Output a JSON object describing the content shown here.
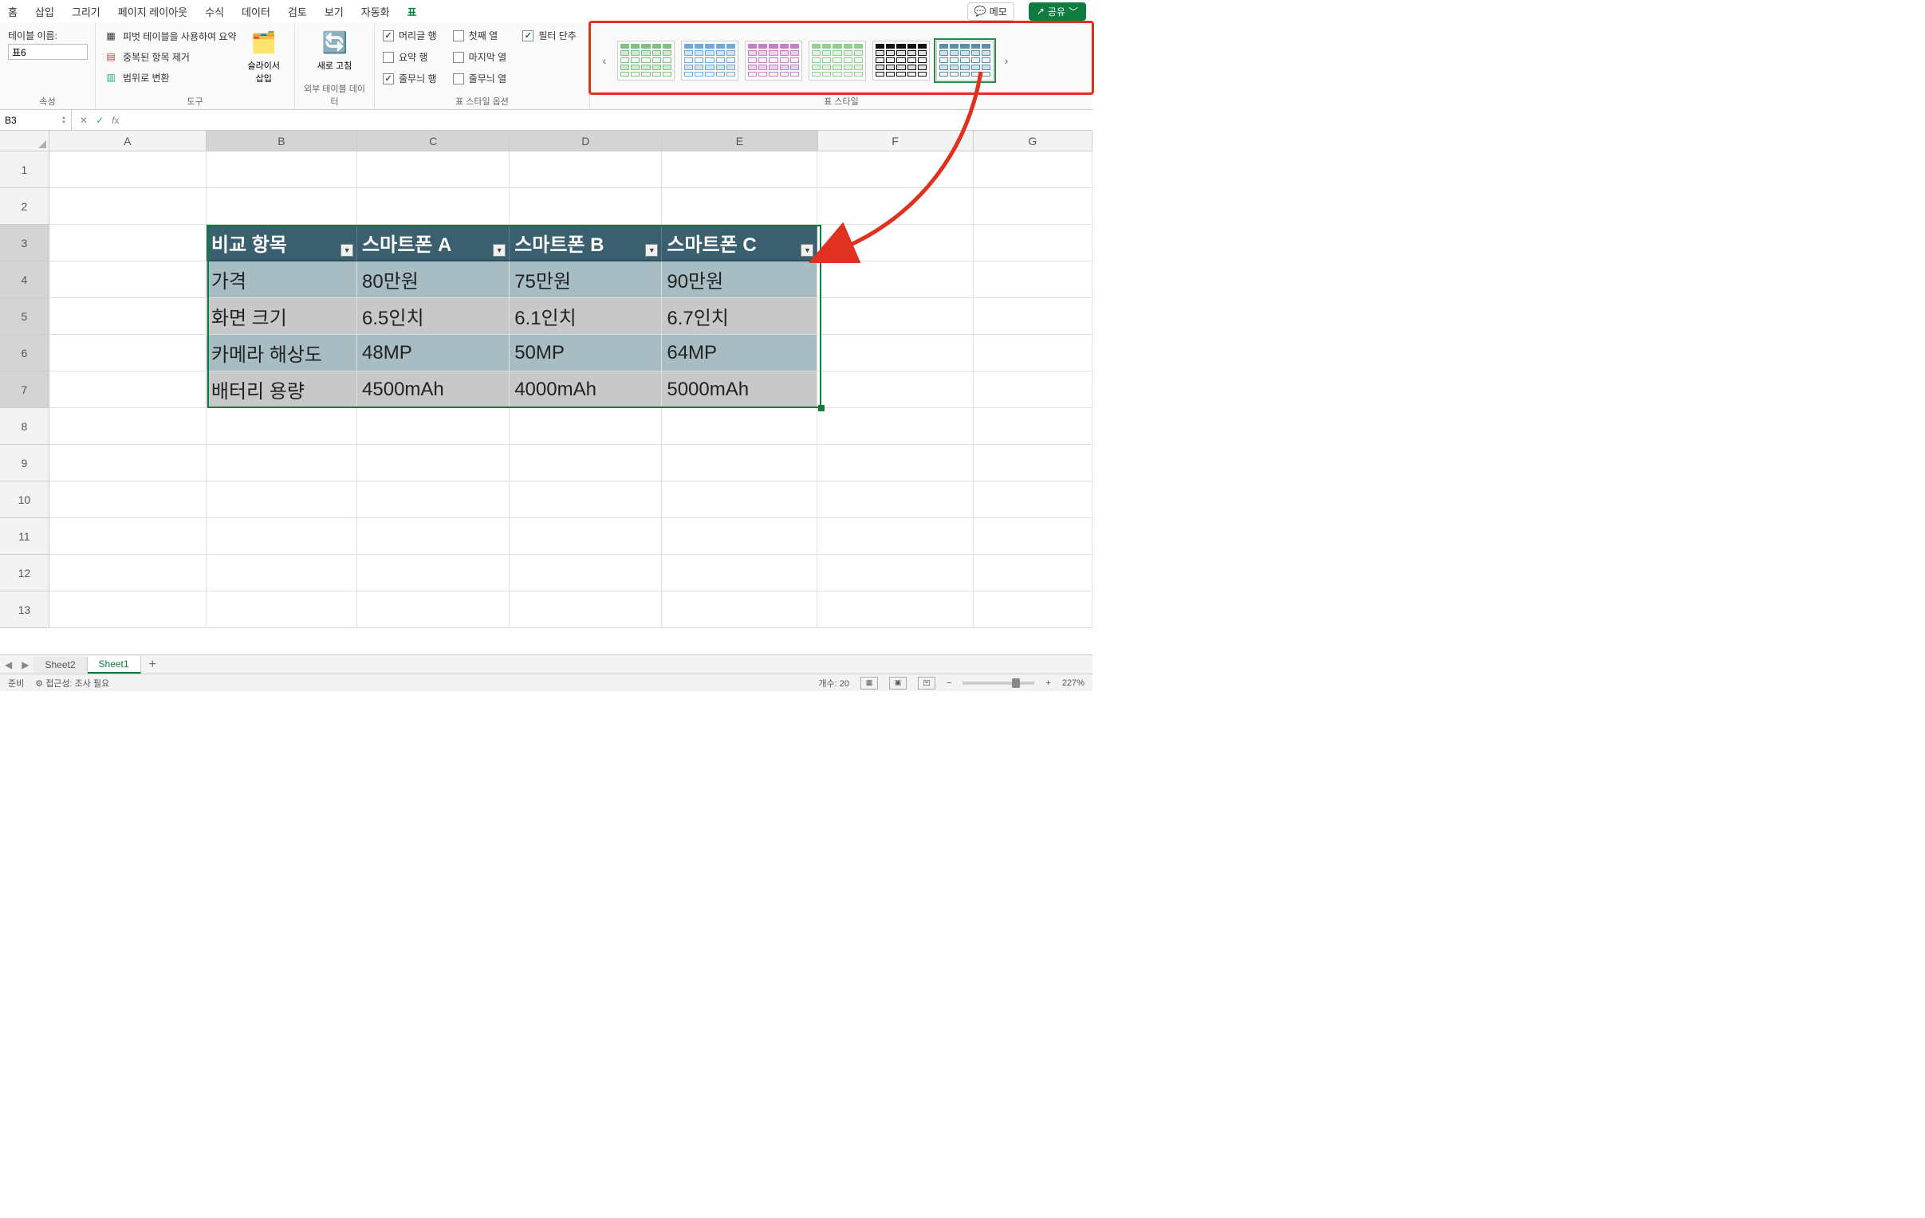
{
  "menu": {
    "home": "홈",
    "insert": "삽입",
    "draw": "그리기",
    "layout": "페이지 레이아웃",
    "formula": "수식",
    "data": "데이터",
    "review": "검토",
    "view": "보기",
    "auto": "자동화",
    "table": "표",
    "memo": "메모",
    "share": "공유"
  },
  "ribbon": {
    "props_label": "속성",
    "table_name_label": "테이블 이름:",
    "table_name_value": "표6",
    "tools_label": "도구",
    "pivot": "피벗 테이블을 사용하여 요약",
    "dedup": "중복된 항목 제거",
    "torange": "범위로 변환",
    "slicer": "슬라이서\n삽입",
    "external_label": "외부 테이블 데이터",
    "refresh": "새로 고침",
    "styleopts_label": "표 스타일 옵션",
    "header_row": "머리글 행",
    "first_col": "첫째 열",
    "filter_btn": "필터 단추",
    "total_row": "요약 행",
    "last_col": "마지막 열",
    "banded_row": "줄무늬 행",
    "banded_col": "줄무늬 열",
    "styles_label": "표 스타일"
  },
  "namebox": "B3",
  "columns": [
    "A",
    "B",
    "C",
    "D",
    "E",
    "F",
    "G"
  ],
  "rows": [
    "1",
    "2",
    "3",
    "4",
    "5",
    "6",
    "7",
    "8",
    "9",
    "10",
    "11",
    "12",
    "13"
  ],
  "table": {
    "headers": [
      "비교 항목",
      "스마트폰 A",
      "스마트폰 B",
      "스마트폰 C"
    ],
    "rows": [
      [
        "가격",
        "80만원",
        "75만원",
        "90만원"
      ],
      [
        "화면 크기",
        "6.5인치",
        "6.1인치",
        "6.7인치"
      ],
      [
        "카메라 해상도",
        "48MP",
        "50MP",
        "64MP"
      ],
      [
        "배터리 용량",
        "4500mAh",
        "4000mAh",
        "5000mAh"
      ]
    ]
  },
  "sheets": {
    "s2": "Sheet2",
    "s1": "Sheet1"
  },
  "status": {
    "ready": "준비",
    "a11y": "접근성: 조사 필요",
    "count": "개수: 20",
    "zoom": "227%"
  }
}
